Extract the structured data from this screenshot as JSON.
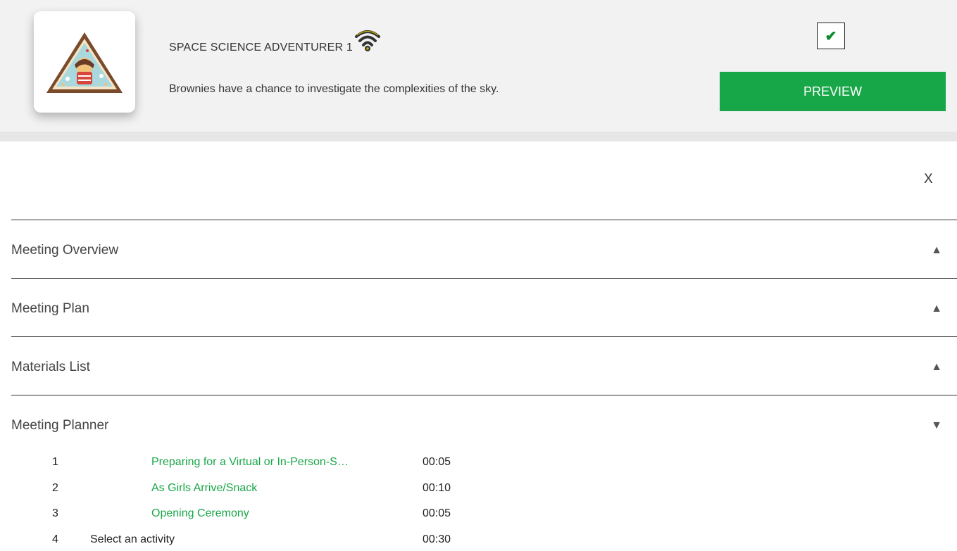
{
  "header": {
    "title": "SPACE SCIENCE ADVENTURER 1",
    "description": "Brownies have a chance to investigate the complexities of the sky.",
    "checkbox_mark": "✔",
    "preview_label": "PREVIEW",
    "badge_icon": "space-science-badge-icon",
    "status_icon": "wifi-signal-icon"
  },
  "close_label": "X",
  "sections": [
    {
      "label": "Meeting Overview",
      "arrow": "▲"
    },
    {
      "label": "Meeting Plan",
      "arrow": "▲"
    },
    {
      "label": "Materials List",
      "arrow": "▲"
    },
    {
      "label": "Meeting Planner",
      "arrow": "▼"
    }
  ],
  "planner": [
    {
      "num": "1",
      "label": "Preparing for a Virtual or In-Person-S…",
      "time": "00:05"
    },
    {
      "num": "2",
      "label": "As Girls Arrive/Snack",
      "time": "00:10"
    },
    {
      "num": "3",
      "label": "Opening Ceremony",
      "time": "00:05"
    },
    {
      "num": "4",
      "label": "Select an activity",
      "time": "00:30"
    }
  ],
  "colors": {
    "accent_green": "#18a748",
    "header_bg": "#f2f2f2",
    "badge_border": "#7a4a2a",
    "badge_fill": "#a9d9df"
  }
}
